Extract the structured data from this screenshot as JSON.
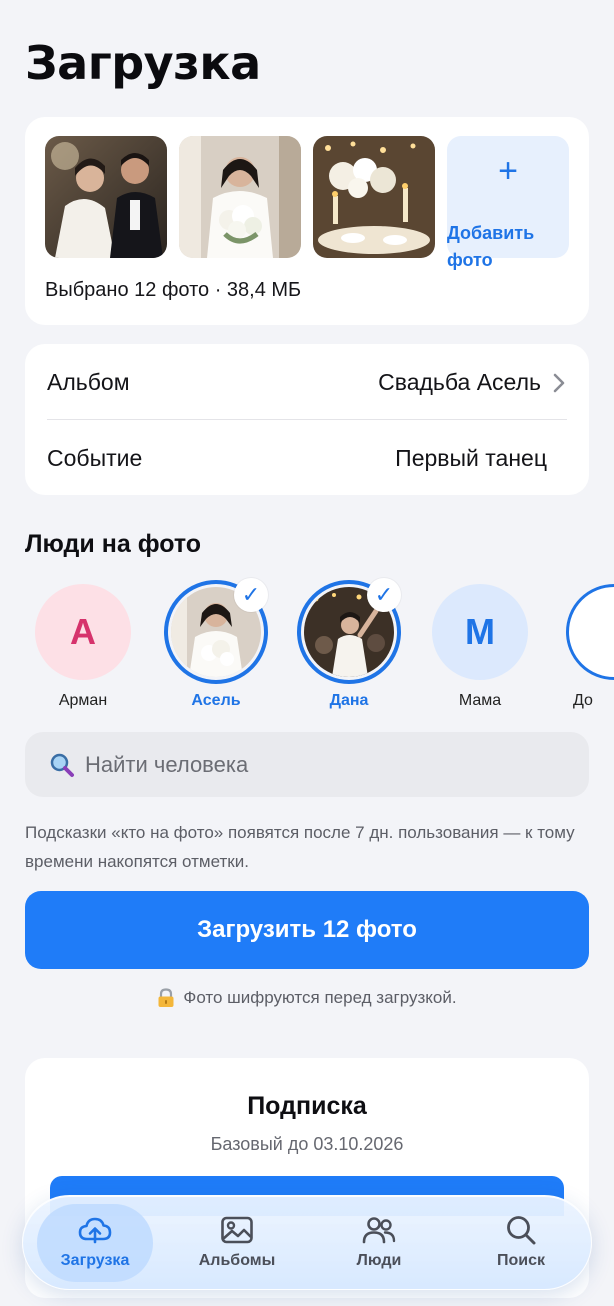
{
  "page": {
    "title": "Загрузка"
  },
  "photos": {
    "add_button_label": "Добавить фото",
    "add_icon": "+",
    "selected_info": "Выбрано 12 фото · 38,4 МБ"
  },
  "details": {
    "album_label": "Альбом",
    "album_value": "Свадьба Асель",
    "event_label": "Событие",
    "event_value": "Первый танец"
  },
  "people": {
    "title": "Люди на фото",
    "items": [
      {
        "name": "Арман",
        "initial": "А",
        "selected": false,
        "bg": "#fde0e6",
        "fg": "#d6336c"
      },
      {
        "name": "Асель",
        "selected": true
      },
      {
        "name": "Дана",
        "selected": true
      },
      {
        "name": "Мама",
        "initial": "М",
        "selected": false,
        "bg": "#dce9fd",
        "fg": "#1f74e6"
      },
      {
        "name": "До",
        "selected": false
      }
    ],
    "check_mark": "✓"
  },
  "search": {
    "placeholder": "Найти человека"
  },
  "hint": "Подсказки «кто на фото» появятся после 7 дн. пользования — к тому времени накопятся отметки.",
  "upload_button": "Загрузить 12 фото",
  "secure_note": "Фото шифруются перед загрузкой.",
  "subscription": {
    "title": "Подписка",
    "description": "Базовый до 03.10.2026"
  },
  "tabs": [
    {
      "label": "Загрузка",
      "icon": "cloud-upload-icon",
      "active": true
    },
    {
      "label": "Альбомы",
      "icon": "image-icon",
      "active": false
    },
    {
      "label": "Люди",
      "icon": "people-icon",
      "active": false
    },
    {
      "label": "Поиск",
      "icon": "search-icon",
      "active": false
    }
  ],
  "colors": {
    "accent": "#1f7cf8",
    "background": "#f3f4f8"
  }
}
